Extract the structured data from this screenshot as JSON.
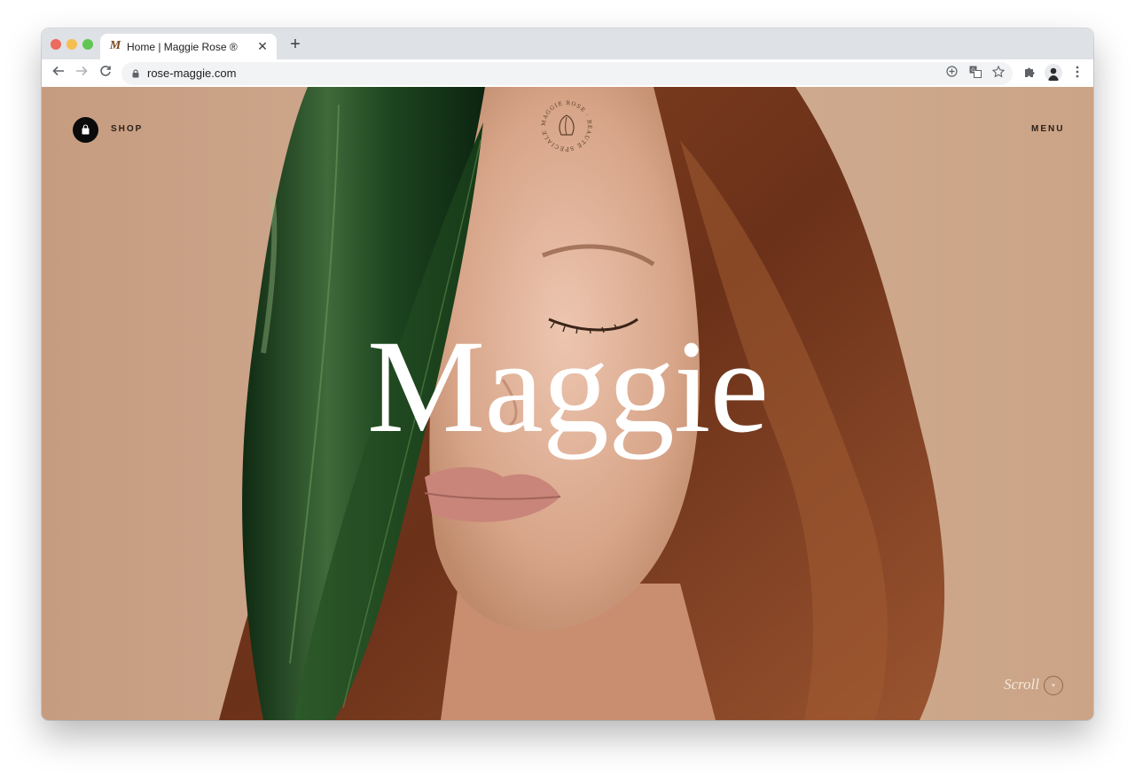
{
  "browser": {
    "tab_title": "Home | Maggie Rose ®",
    "tab_favicon_letter": "M",
    "close_glyph": "✕",
    "new_tab_glyph": "+",
    "url": "rose-maggie.com",
    "icons": [
      "back-icon",
      "forward-icon",
      "reload-icon",
      "lock-icon",
      "add-to-page-icon",
      "translate-icon",
      "bookmark-star-icon",
      "extensions-puzzle-icon",
      "profile-avatar-icon",
      "kebab-menu-icon"
    ]
  },
  "site": {
    "shop_label": "SHOP",
    "menu_label": "MENU",
    "hero_title": "Maggie",
    "seal_text": "MAGGIE ROSE · BEAUTÉ SPÉCIALE",
    "scroll_label": "Scroll"
  },
  "colors": {
    "background_tan": "#c9a285",
    "leaf_green": "#1e3f1e",
    "hair_auburn": "#7a3b1d",
    "accent_gold": "#8a6a4e"
  }
}
